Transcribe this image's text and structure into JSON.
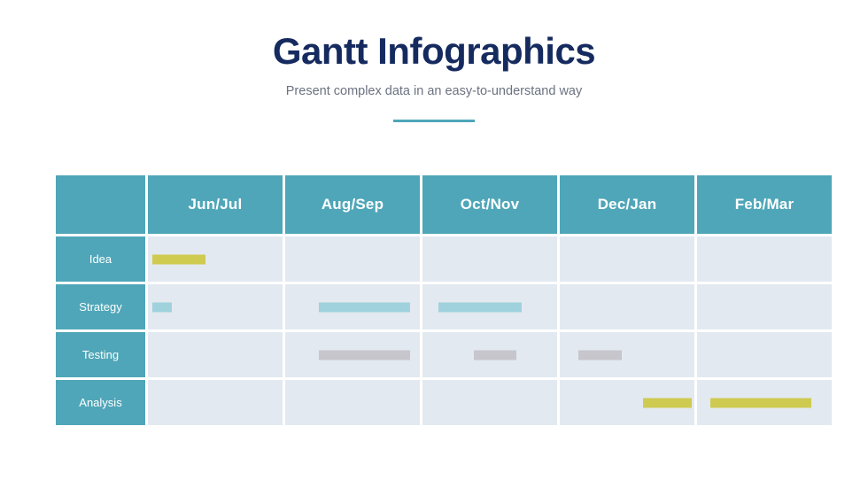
{
  "header": {
    "title": "Gantt Infographics",
    "subtitle": "Present complex data in an easy-to-understand way"
  },
  "colors": {
    "title": "#152a5e",
    "subtitle": "#6b7280",
    "accent_rule": "#4fa6b8",
    "header_teal": "#4fa6b8",
    "cell_background": "#e3e9f0",
    "bar_olive": "#cfcb50",
    "bar_light_blue": "#9fd2dc",
    "bar_gray": "#c6c6cc",
    "page_background": "#ffffff",
    "header_text": "#ffffff"
  },
  "chart_data": {
    "type": "table",
    "title": "Gantt Infographics",
    "subtitle": "Present complex data in an easy-to-understand way",
    "xlabel": "",
    "ylabel": "",
    "grid": false,
    "legend_position": "none",
    "corner_label": "",
    "categories": [
      "Jun/Jul",
      "Aug/Sep",
      "Oct/Nov",
      "Dec/Jan",
      "Feb/Mar"
    ],
    "rows": [
      {
        "label": "Idea",
        "cells": [
          {
            "month": "Jun/Jul",
            "bar": {
              "color": "#cfcb50",
              "left_pct": 3,
              "width_pct": 40
            }
          },
          {
            "month": "Aug/Sep",
            "bar": null
          },
          {
            "month": "Oct/Nov",
            "bar": null
          },
          {
            "month": "Dec/Jan",
            "bar": null
          },
          {
            "month": "Feb/Mar",
            "bar": null
          }
        ]
      },
      {
        "label": "Strategy",
        "cells": [
          {
            "month": "Jun/Jul",
            "bar": {
              "color": "#9fd2dc",
              "left_pct": 3,
              "width_pct": 15
            }
          },
          {
            "month": "Aug/Sep",
            "bar": {
              "color": "#9fd2dc",
              "left_pct": 25,
              "width_pct": 68
            }
          },
          {
            "month": "Oct/Nov",
            "bar": {
              "color": "#9fd2dc",
              "left_pct": 12,
              "width_pct": 62
            }
          },
          {
            "month": "Dec/Jan",
            "bar": null
          },
          {
            "month": "Feb/Mar",
            "bar": null
          }
        ]
      },
      {
        "label": "Testing",
        "cells": [
          {
            "month": "Jun/Jul",
            "bar": null
          },
          {
            "month": "Aug/Sep",
            "bar": {
              "color": "#c6c6cc",
              "left_pct": 25,
              "width_pct": 68
            }
          },
          {
            "month": "Oct/Nov",
            "bar": {
              "color": "#c6c6cc",
              "left_pct": 38,
              "width_pct": 32
            }
          },
          {
            "month": "Dec/Jan",
            "bar": {
              "color": "#c6c6cc",
              "left_pct": 14,
              "width_pct": 32
            }
          },
          {
            "month": "Feb/Mar",
            "bar": null
          }
        ]
      },
      {
        "label": "Analysis",
        "cells": [
          {
            "month": "Jun/Jul",
            "bar": null
          },
          {
            "month": "Aug/Sep",
            "bar": null
          },
          {
            "month": "Oct/Nov",
            "bar": null
          },
          {
            "month": "Dec/Jan",
            "bar": {
              "color": "#cfcb50",
              "left_pct": 62,
              "width_pct": 36
            }
          },
          {
            "month": "Feb/Mar",
            "bar": {
              "color": "#cfcb50",
              "left_pct": 10,
              "width_pct": 75
            }
          }
        ]
      }
    ]
  }
}
